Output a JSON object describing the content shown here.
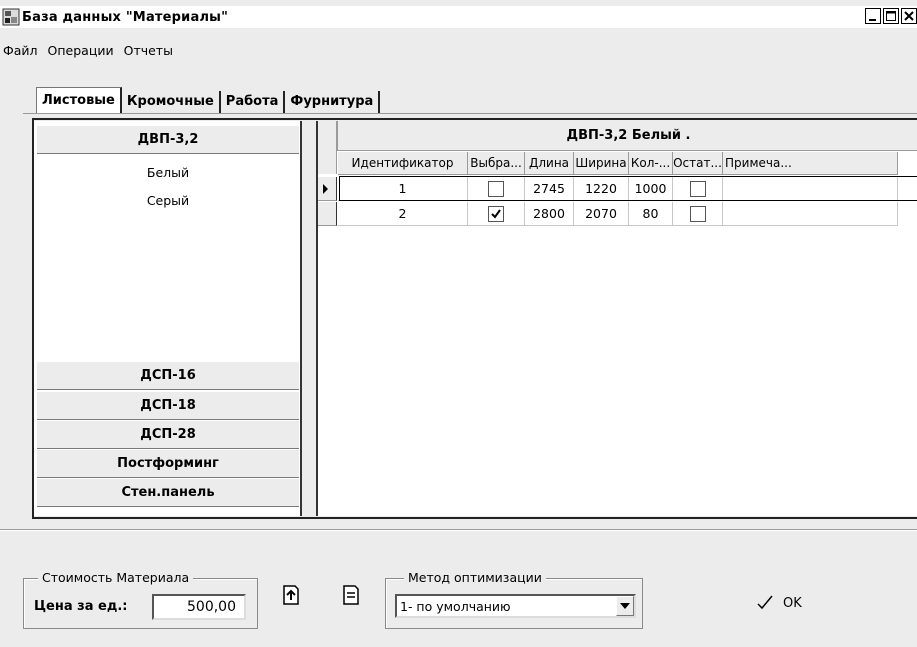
{
  "window": {
    "title": "База данных \"Материалы\"",
    "icon": "database-app-icon",
    "buttons": [
      "minimize-icon",
      "maximize-icon",
      "close-icon"
    ]
  },
  "menu": {
    "items": [
      "Файл",
      "Операции",
      "Отчеты"
    ]
  },
  "tabs": [
    {
      "label": "Листовые",
      "active": true
    },
    {
      "label": "Кромочные",
      "active": false
    },
    {
      "label": "Работа",
      "active": false
    },
    {
      "label": "Фурнитура",
      "active": false
    }
  ],
  "materials": {
    "groups": [
      {
        "label": "ДВП-3,2",
        "expanded": true,
        "items": [
          "Белый",
          "Серый"
        ]
      },
      {
        "label": "ДСП-16"
      },
      {
        "label": "ДСП-18"
      },
      {
        "label": "ДСП-28"
      },
      {
        "label": "Постформинг"
      },
      {
        "label": "Стен.панель"
      }
    ]
  },
  "grid": {
    "title": "ДВП-3,2 Белый .",
    "columns": [
      "Идентификатор",
      "Выбра...",
      "Длина",
      "Ширина",
      "Кол-...",
      "Остат...",
      "Примеча..."
    ],
    "rows": [
      {
        "id": "1",
        "selected": false,
        "length": "2745",
        "width": "1220",
        "count": "1000",
        "remainder": false,
        "note": "",
        "current": true
      },
      {
        "id": "2",
        "selected": true,
        "length": "2800",
        "width": "2070",
        "count": "80",
        "remainder": false,
        "note": "",
        "current": false
      }
    ]
  },
  "cost": {
    "group_label": "Стоимость Материала",
    "price_label": "Цена за ед.:",
    "price_value": "500,00"
  },
  "actions": {
    "import_icon": "import-icon",
    "export_icon": "export-icon"
  },
  "optimization": {
    "group_label": "Метод оптимизации",
    "selected": "1- по умолчанию"
  },
  "ok": {
    "label": "OK",
    "icon": "checkmark-icon"
  }
}
